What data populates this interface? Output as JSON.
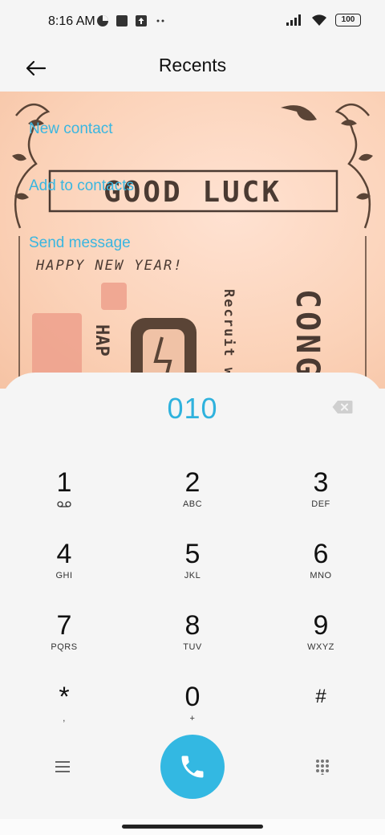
{
  "status_bar": {
    "time": "8:16 AM",
    "battery": "100",
    "icons_left": [
      "app-notification-icon",
      "square-notification-icon",
      "upload-notification-icon",
      "more-dots-icon"
    ],
    "icons_right": [
      "signal-icon",
      "wifi-icon",
      "battery-icon"
    ]
  },
  "header": {
    "title": "Recents",
    "back_icon": "back-arrow-icon"
  },
  "background_card": {
    "headline": "GOOD LUCK",
    "subline": "HAPPY NEW YEAR!",
    "side_text_1": "Recruit w",
    "side_text_2": "CONG",
    "side_text_3": "HAP"
  },
  "actions": {
    "new_contact": "New contact",
    "add_to_contacts": "Add to contacts",
    "send_message": "Send message"
  },
  "dialer": {
    "number": "010",
    "delete_icon": "backspace-icon",
    "keys": [
      {
        "digit": "1",
        "letters": "voicemail-icon"
      },
      {
        "digit": "2",
        "letters": "ABC"
      },
      {
        "digit": "3",
        "letters": "DEF"
      },
      {
        "digit": "4",
        "letters": "GHI"
      },
      {
        "digit": "5",
        "letters": "JKL"
      },
      {
        "digit": "6",
        "letters": "MNO"
      },
      {
        "digit": "7",
        "letters": "PQRS"
      },
      {
        "digit": "8",
        "letters": "TUV"
      },
      {
        "digit": "9",
        "letters": "WXYZ"
      },
      {
        "digit": "*",
        "letters": ","
      },
      {
        "digit": "0",
        "letters": "+"
      },
      {
        "digit": "#",
        "letters": ""
      }
    ],
    "menu_icon": "menu-icon",
    "call_icon": "phone-icon",
    "keypad_icon": "dialpad-icon",
    "accent_color": "#33b8e2"
  }
}
